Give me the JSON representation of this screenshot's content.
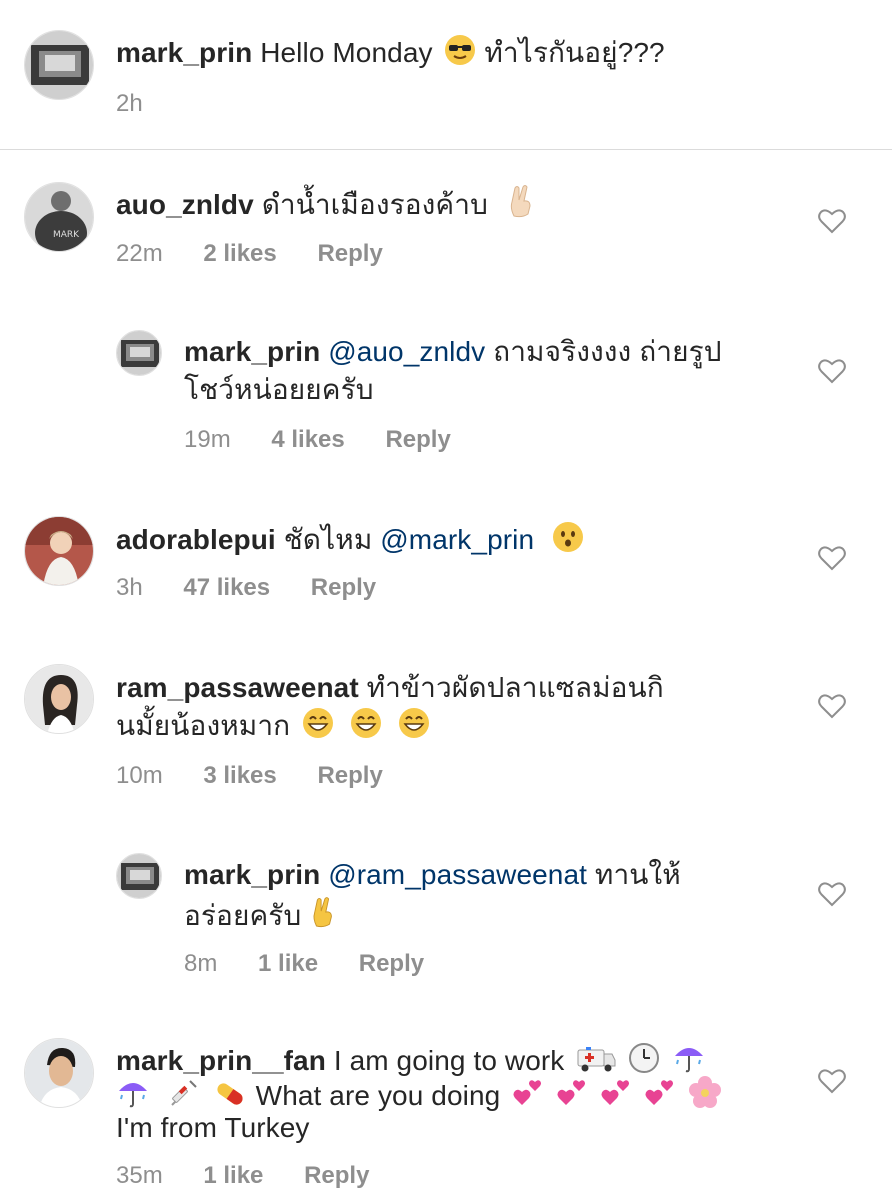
{
  "caption": {
    "username": "mark_prin",
    "text_a": "Hello Monday",
    "emoji_a": "sunglasses-face",
    "text_b": "ทำไรกันอยู่???",
    "time": "2h"
  },
  "comments": [
    {
      "username": "auo_znldv",
      "text": "ดำน้ำเมืองรองค้าบ",
      "emoji": "victory-hand",
      "time": "22m",
      "likes": "2 likes",
      "reply": "Reply"
    },
    {
      "username": "mark_prin",
      "mention": "@auo_znldv",
      "text_line1": "ถามจริงงงง ถ่ายรูป",
      "text_line2": "โชว์หน่อยยครับ",
      "time": "19m",
      "likes": "4 likes",
      "reply": "Reply"
    },
    {
      "username": "adorablepui",
      "text": "ชัดไหม",
      "mention": "@mark_prin",
      "emoji": "hushed-face",
      "time": "3h",
      "likes": "47 likes",
      "reply": "Reply"
    },
    {
      "username": "ram_passaweenat",
      "text_line1": "ทำข้าวผัดปลาแซลม่อนกิ",
      "text_line2": "นมั้ยน้องหมาก",
      "emoji": "grinning-face",
      "time": "10m",
      "likes": "3 likes",
      "reply": "Reply"
    },
    {
      "username": "mark_prin",
      "mention": "@ram_passaweenat",
      "text_line1": "ทานให้",
      "text_line2": "อร่อยครับ",
      "emoji": "victory-hand",
      "time": "8m",
      "likes": "1 like",
      "reply": "Reply"
    },
    {
      "username": "mark_prin__fan",
      "text_line1": "I am going to work",
      "text_line2": "What are you doing",
      "text_line3": "I'm from Turkey",
      "emoji": [
        "ambulance",
        "clock",
        "umbrella-rain",
        "syringe",
        "pill",
        "two-hearts",
        "cherry-blossom"
      ],
      "time": "35m",
      "likes": "1 like",
      "reply": "Reply"
    }
  ],
  "colors": {
    "username": "#262626",
    "mention": "#003569",
    "meta": "#8e8e8e",
    "divider": "#dbdbdb"
  }
}
